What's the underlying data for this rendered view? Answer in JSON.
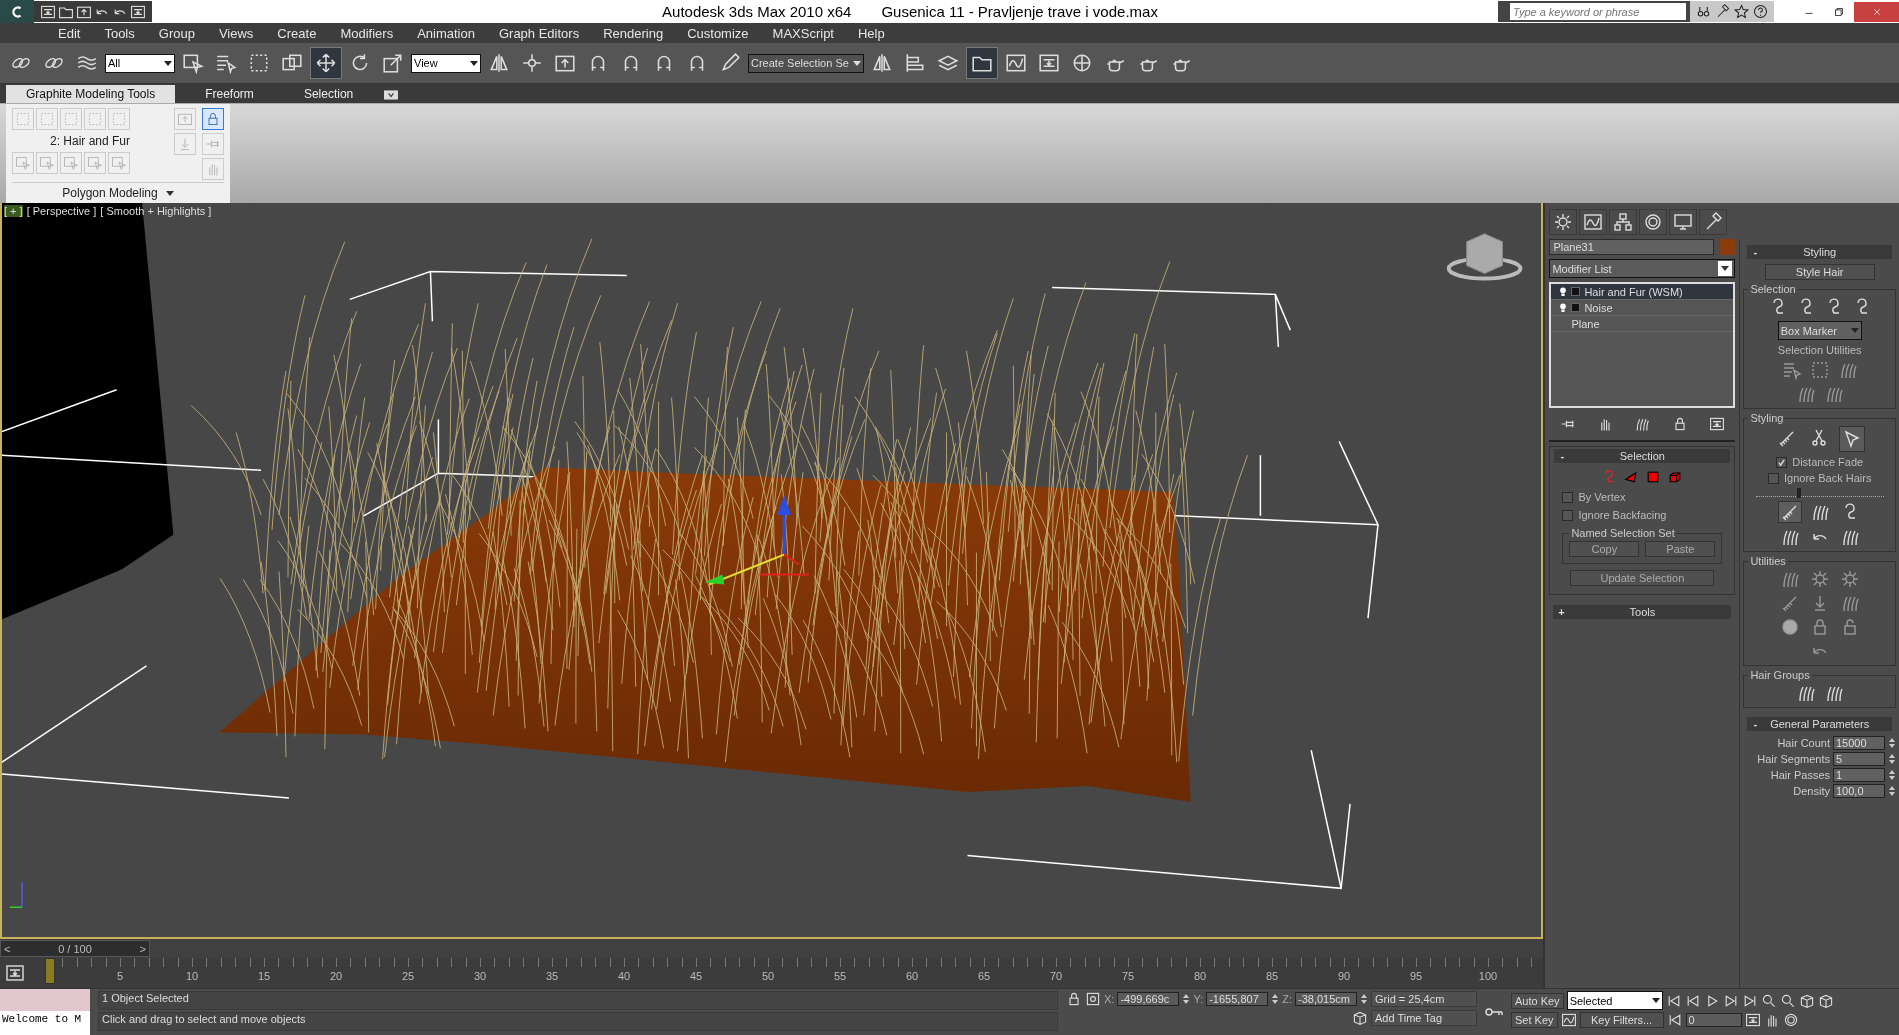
{
  "window": {
    "app_title": "Autodesk 3ds Max  2010 x64",
    "file_title": "Gusenica 11 - Pravljenje trave i vode.max"
  },
  "search": {
    "placeholder": "Type a keyword or phrase"
  },
  "menu": [
    "Edit",
    "Tools",
    "Group",
    "Views",
    "Create",
    "Modifiers",
    "Animation",
    "Graph Editors",
    "Rendering",
    "Customize",
    "MAXScript",
    "Help"
  ],
  "toolbar": {
    "selection_filter": "All",
    "reference_coord": "View",
    "named_selection": "Create Selection Se"
  },
  "ribbon": {
    "tabs": [
      {
        "label": "Graphite Modeling Tools",
        "selected": true
      },
      {
        "label": "Freeform",
        "selected": false
      },
      {
        "label": "Selection",
        "selected": false
      }
    ],
    "panel_text": "2: Hair and Fur",
    "panel_title": "Polygon Modeling"
  },
  "viewport": {
    "labels": [
      "[ + ]",
      "[ Perspective ]",
      "[ Smooth + Highlights ]"
    ]
  },
  "command_panel": {
    "object_name": "Plane31",
    "modifier_list": "Modifier List",
    "stack": [
      {
        "label": "Hair and Fur (WSM)",
        "selected": true,
        "kind": "modifier"
      },
      {
        "label": "Noise",
        "selected": false,
        "kind": "modifier"
      },
      {
        "label": "Plane",
        "selected": false,
        "kind": "base"
      }
    ],
    "selection": {
      "sign": "-",
      "title": "Selection",
      "checkboxes": [
        {
          "label": "By Vertex",
          "checked": false
        },
        {
          "label": "Ignore Backfacing",
          "checked": false
        }
      ],
      "named_set": "Named Selection Set",
      "buttons": [
        "Copy",
        "Paste"
      ],
      "update": "Update Selection"
    },
    "tools": {
      "sign": "+",
      "title": "Tools"
    },
    "styling": {
      "sign": "-",
      "title": "Styling",
      "button": "Style Hair",
      "selection_group": "Selection",
      "marker": "Box Marker",
      "utilities_label": "Selection Utilities",
      "styling_group": "Styling",
      "tools": [
        {
          "selected": false
        },
        {
          "selected": false
        },
        {
          "selected": true
        }
      ],
      "checkboxes": [
        {
          "label": "Distance Fade",
          "checked": true
        },
        {
          "label": "Ignore Back Hairs",
          "checked": false
        }
      ],
      "slider": {
        "level": 0.32
      },
      "utilities_group": "Utilities",
      "hair_groups": "Hair Groups"
    },
    "general": {
      "sign": "-",
      "title": "General Parameters",
      "params": [
        {
          "label": "Hair Count",
          "value": "15000"
        },
        {
          "label": "Hair Segments",
          "value": "5"
        },
        {
          "label": "Hair Passes",
          "value": "1"
        },
        {
          "label": "Density",
          "value": "100,0"
        }
      ]
    }
  },
  "timeline": {
    "level": 0,
    "prev": "<",
    "frame": "0 / 100",
    "next": ">",
    "ticks": [
      "5",
      "10",
      "15",
      "20",
      "25",
      "30",
      "35",
      "40",
      "45",
      "50",
      "55",
      "60",
      "65",
      "70",
      "75",
      "80",
      "85",
      "90",
      "95",
      "100"
    ]
  },
  "status": {
    "listener": "Welcome to M",
    "selected": "1 Object Selected",
    "prompt": "Click and drag to select and move objects",
    "coords": [
      {
        "axis": "X:",
        "value": "-499,669c"
      },
      {
        "axis": "Y:",
        "value": "-1655,807"
      },
      {
        "axis": "Z:",
        "value": "-38,015cm"
      }
    ],
    "grid": "Grid = 25,4cm",
    "add_time_tag": "Add Time Tag"
  },
  "animation": {
    "auto_key": "Auto Key",
    "set_key": "Set Key",
    "key_mode": "Selected",
    "key_filters": "Key Filters...",
    "frame": "0"
  }
}
